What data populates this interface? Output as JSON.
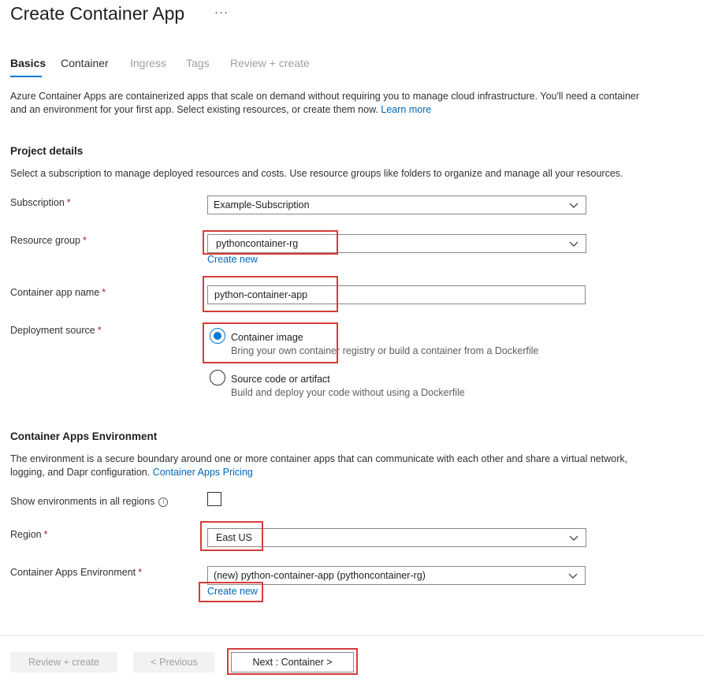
{
  "page": {
    "title": "Create Container App",
    "more_label": "···"
  },
  "tabs": [
    {
      "label": "Basics"
    },
    {
      "label": "Container"
    },
    {
      "label": "Ingress"
    },
    {
      "label": "Tags"
    },
    {
      "label": "Review + create"
    }
  ],
  "intro": {
    "text": "Azure Container Apps are containerized apps that scale on demand without requiring you to manage cloud infrastructure. You'll need a container and an environment for your first app. Select existing resources, or create them now.",
    "link": "Learn more"
  },
  "project": {
    "heading": "Project details",
    "description": "Select a subscription to manage deployed resources and costs. Use resource groups like folders to organize and manage all your resources.",
    "subscription": {
      "label": "Subscription",
      "required": "*",
      "value": "Example-Subscription"
    },
    "resource_group": {
      "label": "Resource group",
      "required": "*",
      "value": "pythoncontainer-rg",
      "create_new": "Create new"
    },
    "app_name": {
      "label": "Container app name",
      "required": "*",
      "value": "python-container-app"
    },
    "deployment": {
      "label": "Deployment source",
      "required": "*",
      "options": [
        {
          "title": "Container image",
          "desc": "Bring your own container registry or build a container from a Dockerfile"
        },
        {
          "title": "Source code or artifact",
          "desc": "Build and deploy your code without using a Dockerfile"
        }
      ]
    }
  },
  "environment": {
    "heading": "Container Apps Environment",
    "description": "The environment is a secure boundary around one or more container apps that can communicate with each other and share a virtual network, logging, and Dapr configuration.",
    "link": "Container Apps Pricing",
    "show_all_regions": {
      "label": "Show environments in all regions",
      "info": "i"
    },
    "region": {
      "label": "Region",
      "required": "*",
      "value": "East US"
    },
    "env": {
      "label": "Container Apps Environment",
      "required": "*",
      "value": "(new) python-container-app (pythoncontainer-rg)",
      "create_new": "Create new"
    }
  },
  "footer": {
    "review": "Review + create",
    "previous": "< Previous",
    "next": "Next : Container >"
  },
  "colors": {
    "accent": "#0078d4",
    "link": "#0067b8",
    "highlight": "#d83b3b"
  }
}
